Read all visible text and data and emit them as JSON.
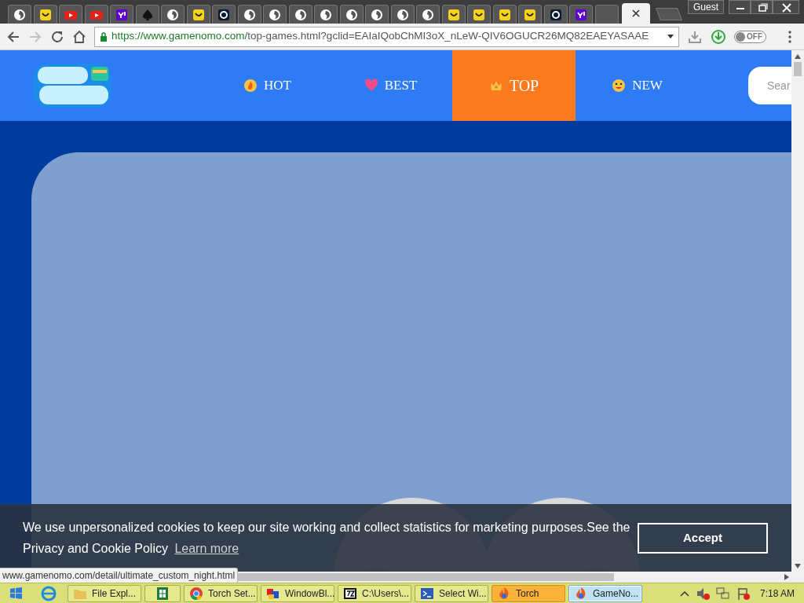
{
  "tabs": [
    {
      "kind": "torch",
      "selected": false
    },
    {
      "kind": "smile",
      "selected": false
    },
    {
      "kind": "youtube",
      "selected": false
    },
    {
      "kind": "youtube",
      "selected": false
    },
    {
      "kind": "yahoo",
      "selected": false
    },
    {
      "kind": "spade",
      "selected": false
    },
    {
      "kind": "torch",
      "selected": false
    },
    {
      "kind": "smile",
      "selected": false
    },
    {
      "kind": "dark",
      "selected": false
    },
    {
      "kind": "torch",
      "selected": false
    },
    {
      "kind": "torch",
      "selected": false
    },
    {
      "kind": "torch",
      "selected": false
    },
    {
      "kind": "torch",
      "selected": false
    },
    {
      "kind": "torch",
      "selected": false
    },
    {
      "kind": "torch",
      "selected": false
    },
    {
      "kind": "torch",
      "selected": false
    },
    {
      "kind": "torch",
      "selected": false
    },
    {
      "kind": "smile",
      "selected": false
    },
    {
      "kind": "smile",
      "selected": false
    },
    {
      "kind": "smile",
      "selected": false
    },
    {
      "kind": "smile",
      "selected": false
    },
    {
      "kind": "dark",
      "selected": false
    },
    {
      "kind": "yahoo",
      "selected": false
    },
    {
      "kind": "blank",
      "selected": false
    },
    {
      "kind": "blank",
      "selected": true
    }
  ],
  "profile": "Guest",
  "address": {
    "origin": "https://www.gamenomo.com",
    "path": "/top-games.html?gclid=EAIaIQobChMI3oX_nLeW-QIV6OGUCR26MQ82EAEYASAAE"
  },
  "toolbar": {
    "forward_disabled": true,
    "extension_toggle": "OFF"
  },
  "nav": [
    {
      "kind": "hot",
      "label": "HOT",
      "selected": false
    },
    {
      "kind": "best",
      "label": "BEST",
      "selected": false
    },
    {
      "kind": "top",
      "label": "TOP",
      "selected": true
    },
    {
      "kind": "new",
      "label": "NEW",
      "selected": false
    }
  ],
  "search": {
    "placeholder": "Sear"
  },
  "cookie_banner": {
    "message": "We use unpersonalized cookies to keep our site working and collect statistics for marketing purposes.See the Privacy and Cookie Policy",
    "link": "Learn more",
    "button": "Accept"
  },
  "status_url": "www.gamenomo.com/detail/ultimate_custom_night.html",
  "taskbar": {
    "items": [
      {
        "kind": "explorer",
        "label": "File Expl...",
        "selected": false,
        "flashing": false
      },
      {
        "kind": "excel",
        "selected": false,
        "flashing": false
      },
      {
        "kind": "chrome",
        "label": "Torch Set...",
        "selected": false,
        "flashing": false
      },
      {
        "kind": "windowblinds",
        "label": "WindowBl...",
        "selected": false,
        "flashing": false
      },
      {
        "kind": "sevenzip",
        "label": "C:\\Users\\...",
        "selected": false,
        "flashing": false
      },
      {
        "kind": "powershell",
        "label": "Select Wi...",
        "selected": false,
        "flashing": false
      },
      {
        "kind": "torch",
        "label": "Torch",
        "selected": false,
        "flashing": true
      },
      {
        "kind": "torch",
        "label": "GameNo...",
        "selected": true,
        "flashing": false
      }
    ],
    "clock": "7:18 AM"
  }
}
